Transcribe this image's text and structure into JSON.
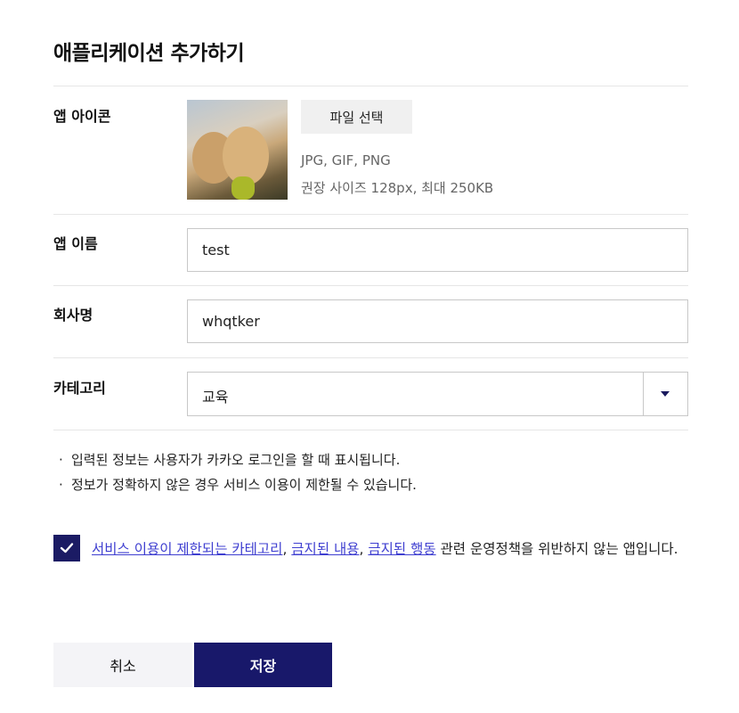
{
  "page": {
    "title": "애플리케이션 추가하기"
  },
  "fields": {
    "icon": {
      "label": "앱 아이콘",
      "file_button": "파일 선택",
      "formats": "JPG, GIF, PNG",
      "size_hint": "권장 사이즈 128px, 최대 250KB"
    },
    "app_name": {
      "label": "앱 이름",
      "value": "test"
    },
    "company": {
      "label": "회사명",
      "value": "whqtker"
    },
    "category": {
      "label": "카테고리",
      "value": "교육"
    }
  },
  "notes": [
    "입력된 정보는 사용자가 카카오 로그인을 할 때 표시됩니다.",
    "정보가 정확하지 않은 경우 서비스 이용이 제한될 수 있습니다."
  ],
  "agreement": {
    "checked": true,
    "link1": "서비스 이용이 제한되는 카테고리",
    "sep1": ", ",
    "link2": "금지된 내용",
    "sep2": ", ",
    "link3": "금지된 행동",
    "suffix": " 관련 운영정책을 위반하지 않는 앱입니다."
  },
  "actions": {
    "cancel": "취소",
    "save": "저장"
  },
  "colors": {
    "primary": "#18186a",
    "link": "#3f3fd0"
  }
}
